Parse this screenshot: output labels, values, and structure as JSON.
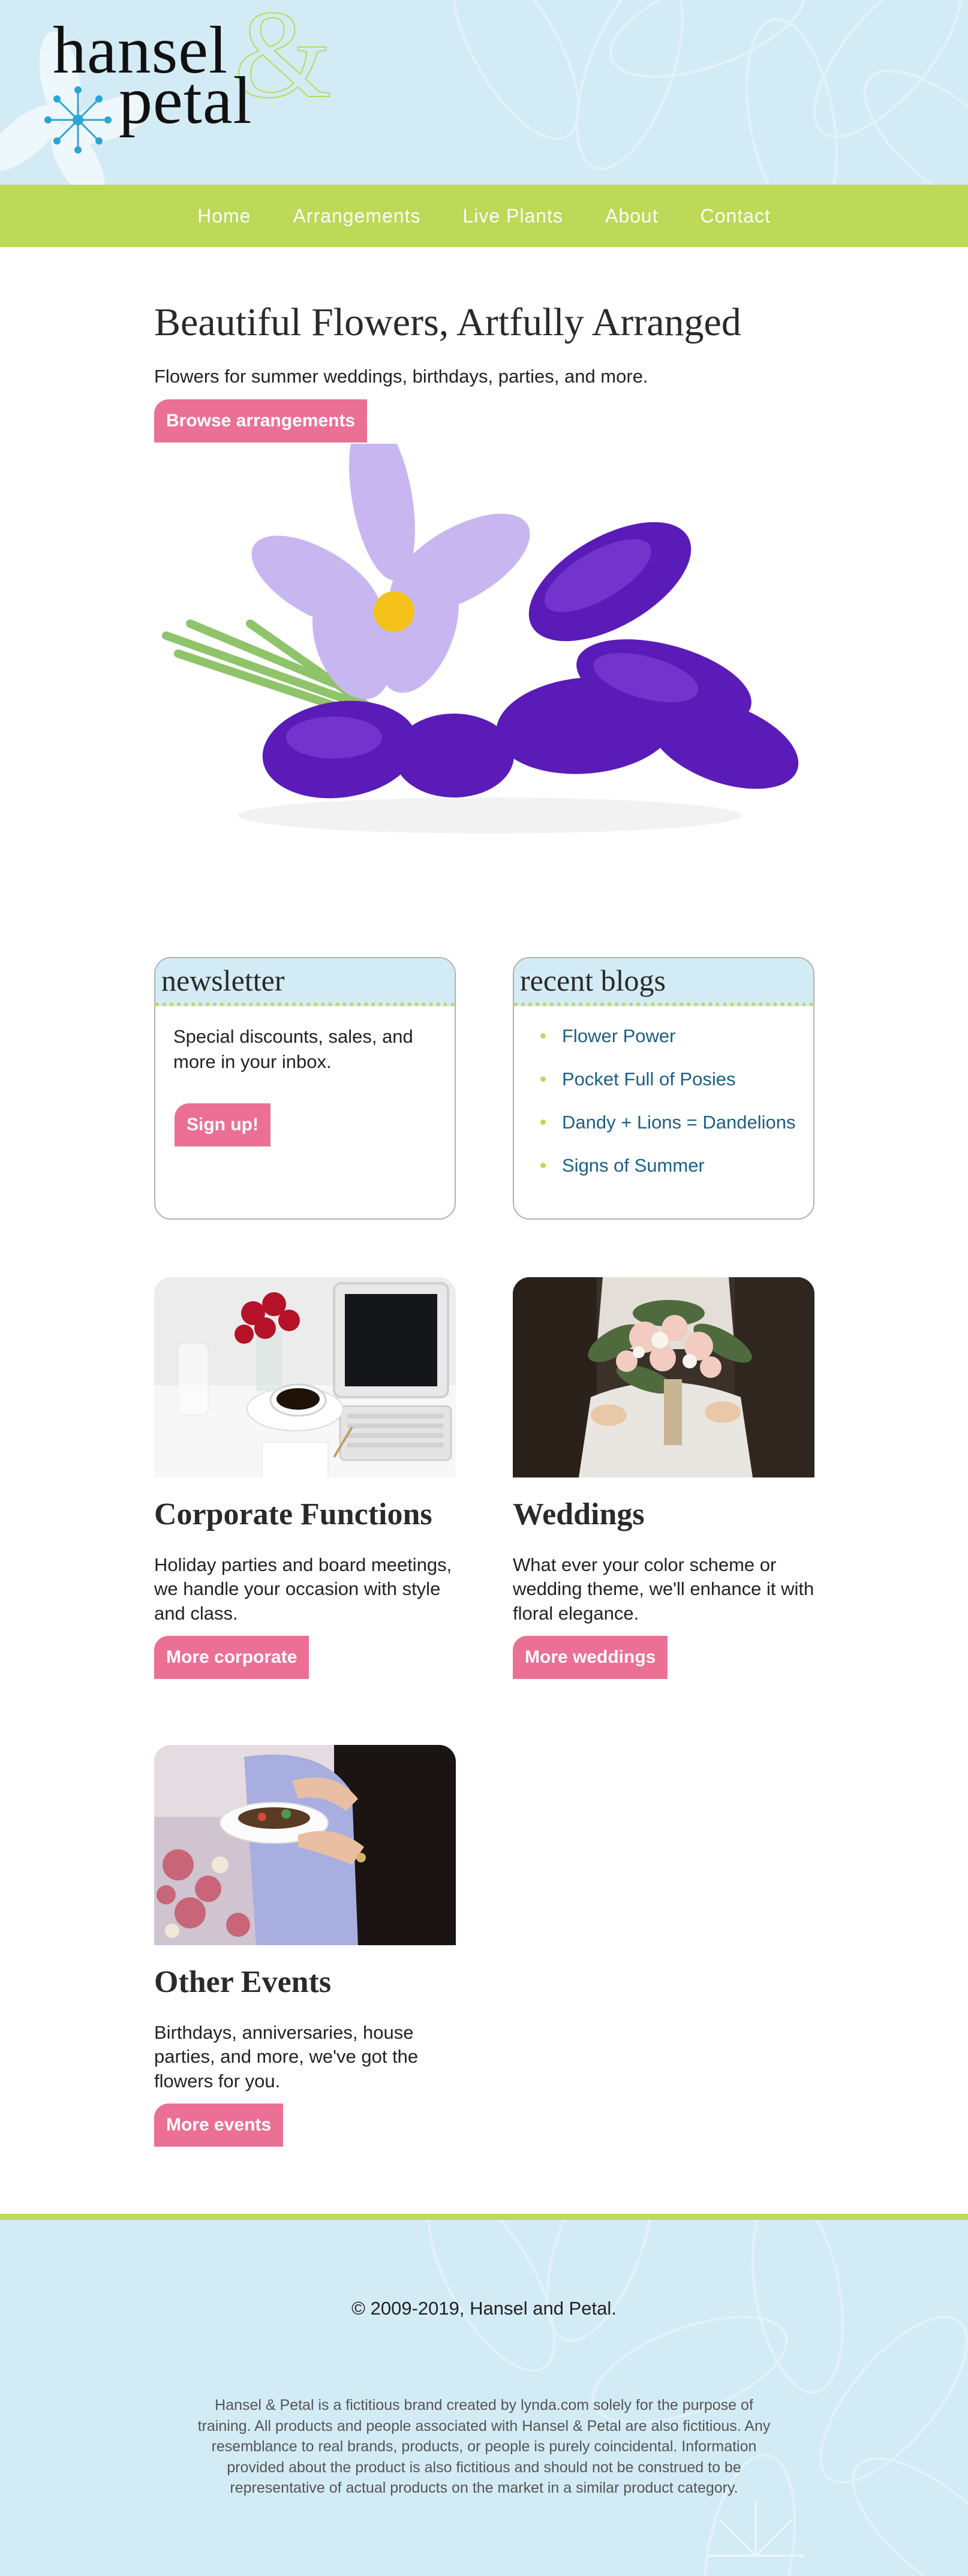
{
  "brand": {
    "line1": "hansel",
    "line2": "petal",
    "ampersand": "&"
  },
  "colors": {
    "accent_green": "#bcd957",
    "sky_blue": "#d3ebf5",
    "button_pink": "#ec7096",
    "link_blue": "#1b5f86"
  },
  "nav": {
    "items": [
      "Home",
      "Arrangements",
      "Live Plants",
      "About",
      "Contact"
    ]
  },
  "hero": {
    "title": "Beautiful Flowers, Artfully Arranged",
    "subtitle": "Flowers for summer weddings, birthdays, parties, and more.",
    "button": "Browse arrangements"
  },
  "newsletter": {
    "heading": "newsletter",
    "text": "Special discounts, sales, and more in your inbox.",
    "button": "Sign up!"
  },
  "blogs": {
    "heading": "recent blogs",
    "items": [
      "Flower Power",
      "Pocket Full of Posies",
      "Dandy + Lions = Dandelions",
      "Signs of Summer"
    ]
  },
  "cards": [
    {
      "title": "Corporate Functions",
      "text": "Holiday parties and board meetings, we handle your occasion with style and class.",
      "button": "More corporate"
    },
    {
      "title": "Weddings",
      "text": "What ever your color scheme or wedding theme, we'll enhance it with floral elegance.",
      "button": "More weddings"
    },
    {
      "title": "Other Events",
      "text": "Birthdays, anniversaries, house parties, and more, we've got the flowers for you.",
      "button": "More events"
    }
  ],
  "footer": {
    "copyright": "© 2009-2019, Hansel and Petal.",
    "disclaimer": "Hansel & Petal is a fictitious brand created by lynda.com solely for the purpose of training. All products and people associated with Hansel & Petal are also fictitious. Any resemblance to real brands, products, or people is purely coincidental. Information provided about the product is also fictitious and should not be construed to be representative of actual products on the market in a similar product category."
  }
}
